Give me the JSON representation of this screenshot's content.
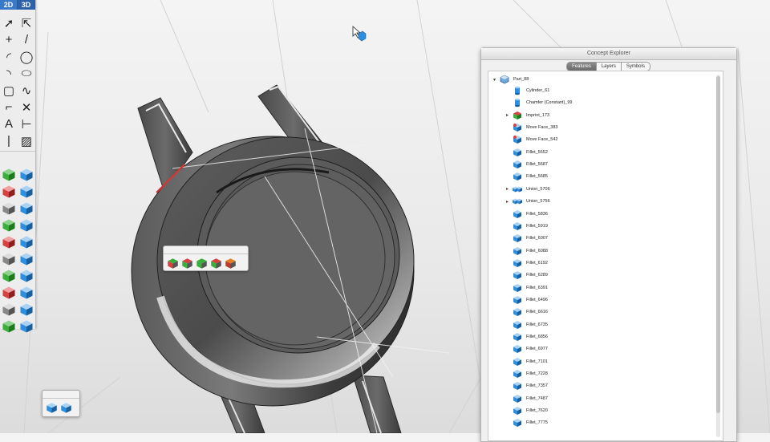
{
  "toolbar": {
    "mode_2d": "2D",
    "mode_3d": "3D",
    "tools": [
      {
        "name": "select-icon",
        "glyph": "➚"
      },
      {
        "name": "select-alt-icon",
        "glyph": "⇱"
      },
      {
        "name": "point-icon",
        "glyph": "+"
      },
      {
        "name": "line-icon",
        "glyph": "/"
      },
      {
        "name": "arc-icon",
        "glyph": "◜"
      },
      {
        "name": "circle-icon",
        "glyph": "◯"
      },
      {
        "name": "arc-three-point-icon",
        "glyph": "◝"
      },
      {
        "name": "ellipse-icon",
        "glyph": "⬭"
      },
      {
        "name": "rectangle-icon",
        "glyph": "▢"
      },
      {
        "name": "spline-icon",
        "glyph": "∿"
      },
      {
        "name": "fillet-2d-icon",
        "glyph": "⌐"
      },
      {
        "name": "trim-icon",
        "glyph": "✕"
      },
      {
        "name": "text-icon",
        "glyph": "A"
      },
      {
        "name": "dimension-icon",
        "glyph": "⊢"
      },
      {
        "name": "construction-line-icon",
        "glyph": "|"
      },
      {
        "name": "hatch-icon",
        "glyph": "▨"
      }
    ],
    "tools3d": [
      "transform-icon",
      "align-icon",
      "extrude-icon",
      "box-icon",
      "sweep-icon",
      "pipe-icon",
      "revolve-icon",
      "shell-icon",
      "imprint-icon",
      "pushpull-icon",
      "fillet-icon",
      "boolean-icon",
      "light-icon",
      "material-icon",
      "pan-icon",
      "zoom-icon",
      "orbit-icon",
      "view-cube-icon",
      "render-mode-icon",
      "wireframe-icon"
    ]
  },
  "floating_toolbar": {
    "icons": [
      "extrude-face-icon",
      "taper-face-icon",
      "offset-face-icon",
      "move-face-icon",
      "delete-face-icon"
    ]
  },
  "bottom_hud": {
    "icons": [
      "cube-solid-icon",
      "cube-select-icon"
    ]
  },
  "concept_explorer": {
    "title": "Concept Explorer",
    "tabs": [
      "Features",
      "Layers",
      "Symbols"
    ],
    "active_tab": "Features",
    "root": {
      "label": "Part_88",
      "expanded": true
    },
    "items": [
      {
        "label": "Cylinder_61",
        "icon": "cylinder",
        "disclosure": ""
      },
      {
        "label": "Chamfer (Constant)_99",
        "icon": "cylinder",
        "disclosure": ""
      },
      {
        "label": "Imprint_173",
        "icon": "imprint",
        "disclosure": "▸"
      },
      {
        "label": "Move Face_383",
        "icon": "moveface",
        "disclosure": ""
      },
      {
        "label": "Move Face_542",
        "icon": "moveface",
        "disclosure": ""
      },
      {
        "label": "Fillet_5652",
        "icon": "cube",
        "disclosure": ""
      },
      {
        "label": "Fillet_5687",
        "icon": "cube",
        "disclosure": ""
      },
      {
        "label": "Fillet_5685",
        "icon": "cube",
        "disclosure": ""
      },
      {
        "label": "Union_5706",
        "icon": "union",
        "disclosure": "▸"
      },
      {
        "label": "Union_5756",
        "icon": "union",
        "disclosure": "▸"
      },
      {
        "label": "Fillet_5836",
        "icon": "cube",
        "disclosure": ""
      },
      {
        "label": "Fillet_5919",
        "icon": "cube",
        "disclosure": ""
      },
      {
        "label": "Fillet_6007",
        "icon": "cube",
        "disclosure": ""
      },
      {
        "label": "Fillet_6088",
        "icon": "cube",
        "disclosure": ""
      },
      {
        "label": "Fillet_6192",
        "icon": "cube",
        "disclosure": ""
      },
      {
        "label": "Fillet_6289",
        "icon": "cube",
        "disclosure": ""
      },
      {
        "label": "Fillet_6391",
        "icon": "cube",
        "disclosure": ""
      },
      {
        "label": "Fillet_6496",
        "icon": "cube",
        "disclosure": ""
      },
      {
        "label": "Fillet_6616",
        "icon": "cube",
        "disclosure": ""
      },
      {
        "label": "Fillet_6735",
        "icon": "cube",
        "disclosure": ""
      },
      {
        "label": "Fillet_6856",
        "icon": "cube",
        "disclosure": ""
      },
      {
        "label": "Fillet_6977",
        "icon": "cube",
        "disclosure": ""
      },
      {
        "label": "Fillet_7101",
        "icon": "cube",
        "disclosure": ""
      },
      {
        "label": "Fillet_7228",
        "icon": "cube",
        "disclosure": ""
      },
      {
        "label": "Fillet_7357",
        "icon": "cube",
        "disclosure": ""
      },
      {
        "label": "Fillet_7487",
        "icon": "cube",
        "disclosure": ""
      },
      {
        "label": "Fillet_7620",
        "icon": "cube",
        "disclosure": ""
      },
      {
        "label": "Fillet_7775",
        "icon": "cube",
        "disclosure": ""
      }
    ]
  },
  "colors": {
    "accent": "#3a78c8",
    "cube_blue": "#2d8fe0",
    "model_dark": "#3d3d3d"
  }
}
